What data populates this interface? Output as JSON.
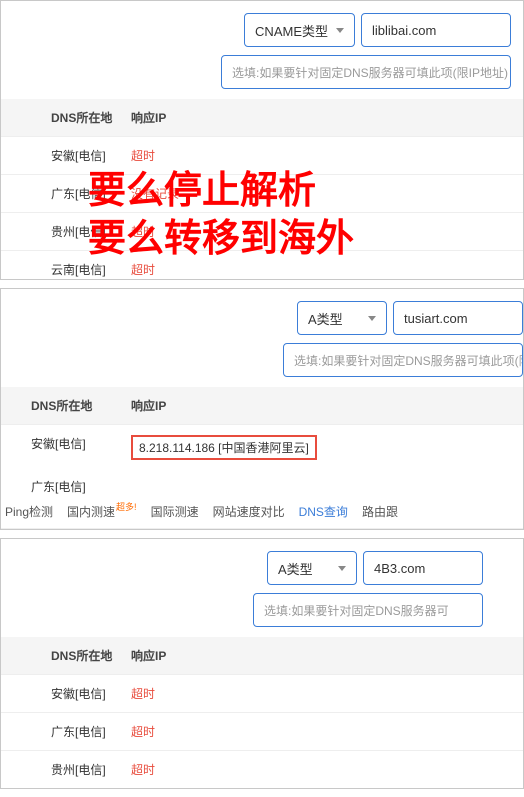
{
  "overlay": {
    "line1": "要么停止解析",
    "line2": "要么转移到海外"
  },
  "panel1": {
    "record_type": "CNAME类型",
    "domain": "liblibai.com",
    "hint": "选填:如果要针对固定DNS服务器可填此项(限IP地址)",
    "headers": {
      "loc": "DNS所在地",
      "ip": "响应IP"
    },
    "rows": [
      {
        "loc": "安徽[电信]",
        "ip": "超时",
        "red": true
      },
      {
        "loc": "广东[电信]",
        "ip": "没有记录",
        "red": true
      },
      {
        "loc": "贵州[电信]",
        "ip": "超时",
        "red": true
      },
      {
        "loc": "云南[电信]",
        "ip": "超时",
        "red": true
      }
    ]
  },
  "panel2": {
    "record_type": "A类型",
    "domain": "tusiart.com",
    "hint": "选填:如果要针对固定DNS服务器可填此项(限IP地",
    "headers": {
      "loc": "DNS所在地",
      "ip": "响应IP"
    },
    "rows": [
      {
        "loc": "安徽[电信]",
        "ip": "8.218.114.186 [中国香港阿里云]",
        "highlight": true
      }
    ],
    "truncated_loc": "广东[电信]",
    "tabs": {
      "ping": "Ping检测",
      "domestic": "国内测速",
      "badge": "超多!",
      "intl": "国际测速",
      "speed_compare": "网站速度对比",
      "dns_query": "DNS查询",
      "route_trace": "路由跟"
    }
  },
  "panel3": {
    "record_type": "A类型",
    "domain": "4B3.com",
    "hint": "选填:如果要针对固定DNS服务器可",
    "headers": {
      "loc": "DNS所在地",
      "ip": "响应IP"
    },
    "rows": [
      {
        "loc": "安徽[电信]",
        "ip": "超时",
        "red": true
      },
      {
        "loc": "广东[电信]",
        "ip": "超时",
        "red": true
      },
      {
        "loc": "贵州[电信]",
        "ip": "超时",
        "red": true
      }
    ]
  }
}
